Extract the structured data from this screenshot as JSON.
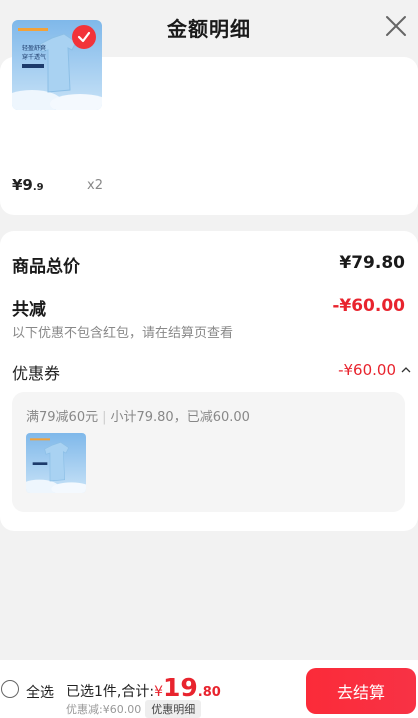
{
  "header": {
    "title": "金额明细"
  },
  "item": {
    "price_main": "¥9",
    "price_decimal": ".9",
    "quantity": "x2",
    "image_text_line1": "轻盈舒爽",
    "image_text_line2": "穿千透气"
  },
  "summary": {
    "goods_total_label": "商品总价",
    "goods_total_value": "¥79.80",
    "reduction_label": "共减",
    "reduction_value": "-¥60.00",
    "reduction_note": "以下优惠不包含红包，请在结算页查看",
    "coupon_label": "优惠券",
    "coupon_value": "-¥60.00",
    "coupon_rule": "满79减60元",
    "coupon_detail": "小计79.80，已减60.00"
  },
  "bottom": {
    "select_all_label": "全选",
    "selected_text": "已选1件,合计:",
    "total_currency": "¥",
    "total_int": "19",
    "total_dec": ".80",
    "discount_text": "优惠减:¥60.00",
    "detail_label": "优惠明细",
    "checkout_label": "去结算"
  },
  "colors": {
    "accent_red": "#e8242e",
    "button_red": "#fb2b39"
  },
  "icons": {
    "close": "close-icon",
    "check": "check-icon",
    "chevron": "chevron-up-icon"
  }
}
